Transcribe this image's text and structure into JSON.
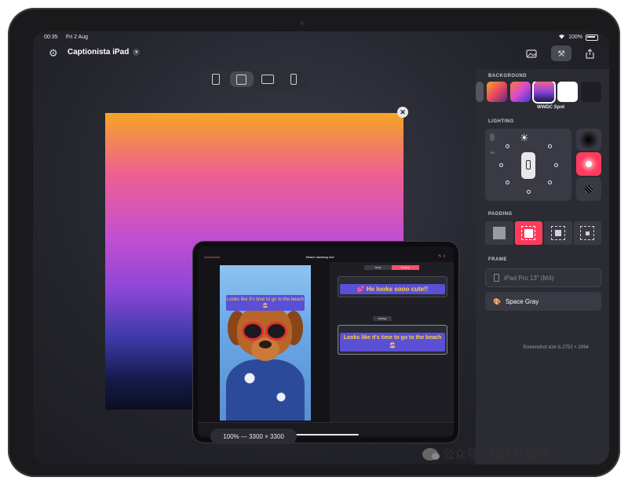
{
  "status": {
    "time": "00:35",
    "date": "Fri 2 Aug",
    "battery": "100%"
  },
  "app": {
    "title": "Captionista iPad"
  },
  "icons": {
    "settings": "gear-icon",
    "gallery": "photo-icon",
    "tools": "paintbrush-hammer-icon",
    "share": "share-icon",
    "close": "close-icon",
    "chevron": "chevron-down-icon"
  },
  "canvas": {
    "zoom_label": "100% — 3300 × 3300"
  },
  "inner_app": {
    "left_title": "Documents",
    "center_title": "Beach dawwwg reel",
    "tabs": [
      "Script",
      "Timeline"
    ],
    "video_caption": "Looks like it's time to go to the beach 🏖️",
    "caption1": "💕 He looks sooo cute!!",
    "settings_label": "Settings",
    "caption2": "Looks like it's time to go to the beach 🏖️"
  },
  "panel": {
    "background_label": "BACKGROUND",
    "selected_background": "WWDC Spot",
    "lighting_label": "LIGHTING",
    "lighting_toggle": "ON",
    "padding_label": "PADDING",
    "frame_label": "FRAME",
    "frame_device": "iPad Pro 13\" (M4)",
    "frame_color": "Space Gray",
    "screenshot_size": "Screenshot size is 2752 × 2064"
  },
  "colors": {
    "accent": "#ff3b5c",
    "panel": "#2b2b33",
    "caption_bg": "#5b4fd6",
    "caption_text": "#ffd23f"
  },
  "watermark": {
    "text": "公众号 · 程序员黎明"
  }
}
